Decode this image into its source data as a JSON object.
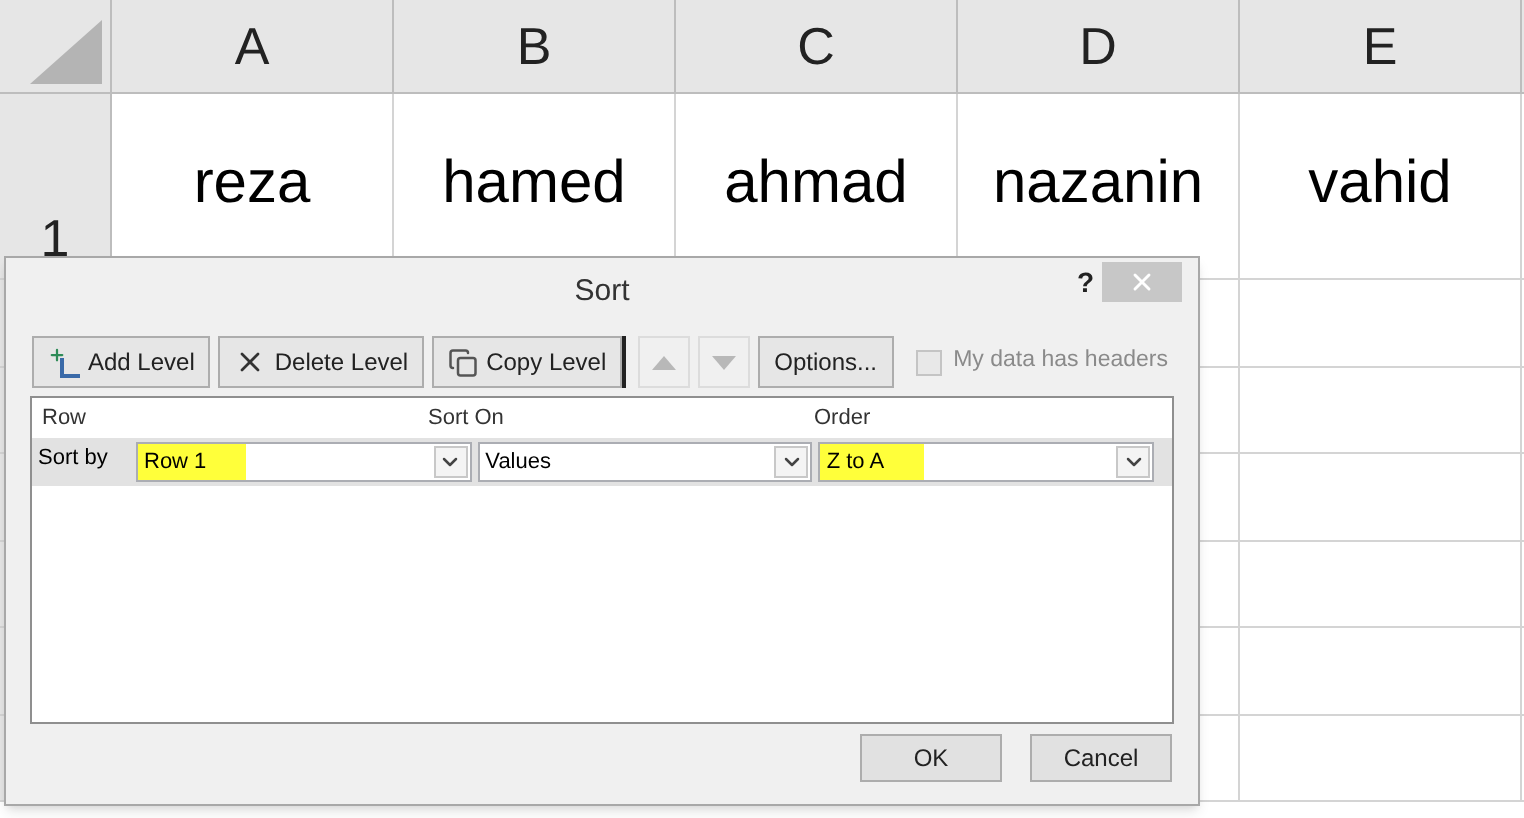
{
  "sheet": {
    "columns": [
      "A",
      "B",
      "C",
      "D",
      "E"
    ],
    "rows": [
      {
        "header": "1",
        "cells": [
          "reza",
          "hamed",
          "ahmad",
          "nazanin",
          "vahid"
        ]
      }
    ]
  },
  "dialog": {
    "title": "Sort",
    "help": "?",
    "toolbar": [
      {
        "kind": "button",
        "label": "Add Level",
        "disabled": false
      },
      {
        "kind": "button",
        "label": "Delete Level",
        "disabled": false
      },
      {
        "kind": "button",
        "label": "Copy Level",
        "disabled": false
      },
      {
        "kind": "arrow",
        "disabled": true
      },
      {
        "kind": "arrow",
        "disabled": true
      },
      {
        "kind": "button",
        "label": "Options...",
        "disabled": false
      }
    ],
    "headers_checkbox": {
      "label": "My data has headers",
      "checked": false,
      "disabled": true
    },
    "columns": [
      "Row",
      "Sort On",
      "Order"
    ],
    "levels": [
      {
        "label": "Sort by",
        "selected": true,
        "fields": [
          {
            "value": "Row 1",
            "highlighted": true
          },
          {
            "value": "Values",
            "highlighted": false
          },
          {
            "value": "Z to A",
            "highlighted": true
          }
        ]
      }
    ],
    "buttons": [
      "OK",
      "Cancel"
    ]
  }
}
